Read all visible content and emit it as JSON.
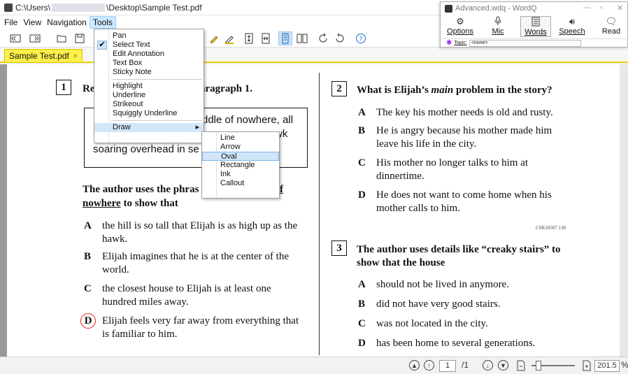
{
  "window": {
    "title_prefix": "C:\\Users\\",
    "title_suffix": "\\Desktop\\Sample Test.pdf"
  },
  "menubar": {
    "items": [
      "File",
      "View",
      "Navigation",
      "Tools"
    ]
  },
  "tab": {
    "label": "Sample Test.pdf",
    "close": "×"
  },
  "tools_menu": {
    "items": [
      "Pan",
      "Select Text",
      "Edit Annotation",
      "Text Box",
      "Sticky Note",
      "Highlight",
      "Underline",
      "Strikeout",
      "Squiggly Underline",
      "Draw"
    ],
    "checked": "Select Text"
  },
  "draw_submenu": {
    "items": [
      "Line",
      "Arrow",
      "Oval",
      "Rectangle",
      "Ink",
      "Callout"
    ],
    "highlighted": "Oval"
  },
  "wordq": {
    "title": "Advanced.wdq - WordQ",
    "buttons": [
      "Options",
      "Mic",
      "Words",
      "Speech",
      "Read"
    ],
    "topic_label": "Topic:",
    "topic_value": "<none>"
  },
  "document": {
    "q1": {
      "num": "1",
      "prompt_start": "Re",
      "prompt_end": "aragraph 1.",
      "passage_line1": "ddle of nowhere, all",
      "passage_line2": "wk",
      "passage_line3": "soaring overhead in se",
      "stem_start": "The author uses the phras",
      "stem_end": "f",
      "stem_line2_underlined": "nowhere",
      "stem_line2_rest": " to show that",
      "options": [
        {
          "letter": "A",
          "text": "the hill is so tall that Elijah is as high up as the hawk."
        },
        {
          "letter": "B",
          "text": "Elijah imagines that he is at the center of the world."
        },
        {
          "letter": "C",
          "text": "the closest house to Elijah is at least one hundred miles away."
        },
        {
          "letter": "D",
          "text": "Elijah feels very far away from everything that is familiar to him."
        }
      ]
    },
    "q2": {
      "num": "2",
      "prompt_before": "What is Elijah’s ",
      "prompt_em": "main",
      "prompt_after": " problem in the story?",
      "options": [
        {
          "letter": "A",
          "text": "The key his mother needs is old and rusty."
        },
        {
          "letter": "B",
          "text": "He is angry because his mother made him leave his life in the city."
        },
        {
          "letter": "C",
          "text": "His mother no longer talks to him at dinnertime."
        },
        {
          "letter": "D",
          "text": "He does not want to come home when his mother calls to him."
        }
      ],
      "code": "CSR10507.138"
    },
    "q3": {
      "num": "3",
      "prompt": "The author uses details like “creaky stairs” to show that the house",
      "options": [
        {
          "letter": "A",
          "text": "should not be lived in anymore."
        },
        {
          "letter": "B",
          "text": "did not have very good stairs."
        },
        {
          "letter": "C",
          "text": "was not located in the city."
        },
        {
          "letter": "D",
          "text": "has been home to several generations."
        }
      ]
    }
  },
  "statusbar": {
    "page_current": "1",
    "page_total": "/1",
    "zoom": "201.5",
    "zoom_unit": "%"
  }
}
